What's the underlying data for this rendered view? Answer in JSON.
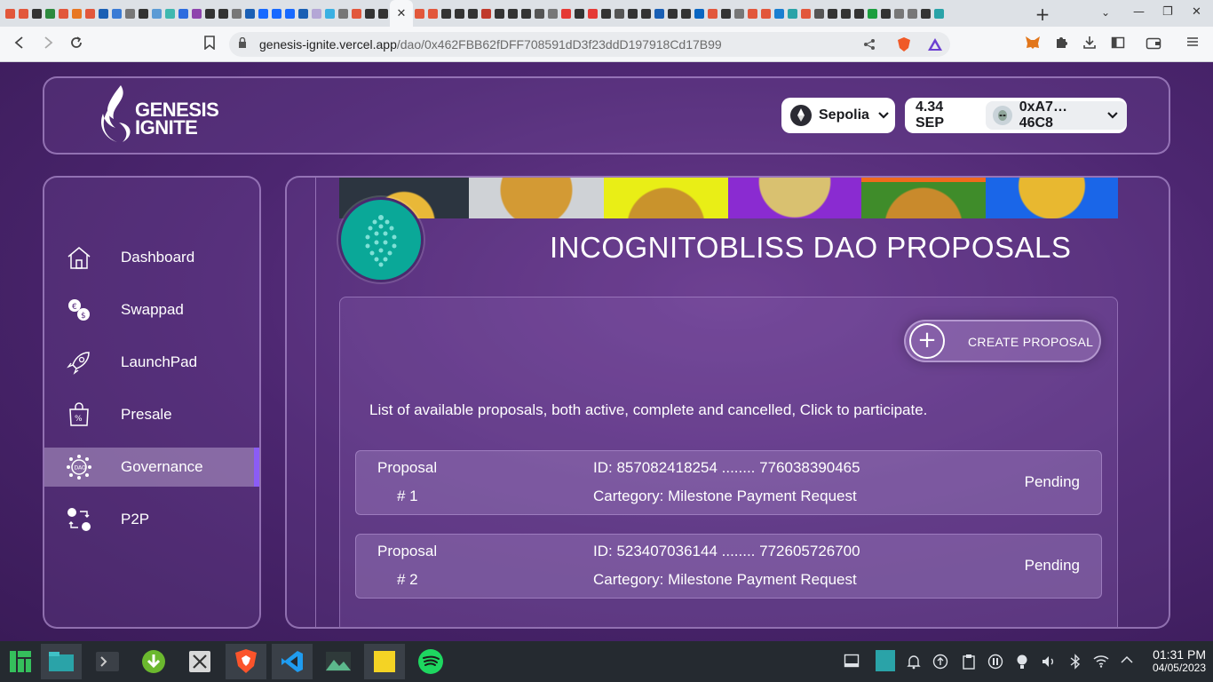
{
  "browser": {
    "url_host": "genesis-ignite.vercel.app",
    "url_path": "/dao/0x462FBB62fDFF708591dD3f23ddD197918Cd17B99",
    "tab_close_glyph": "✕",
    "new_tab_glyph": "+",
    "tab_list_glyph": "⌄",
    "minimize_glyph": "—",
    "restore_glyph": "❐",
    "close_glyph": "✕"
  },
  "header": {
    "logo_line1": "GENESIS",
    "logo_line2": "IGNITE",
    "network": "Sepolia",
    "balance": "4.34 SEP",
    "address": "0xA7…46C8"
  },
  "sidebar": {
    "items": [
      {
        "label": "Dashboard",
        "icon": "home-icon"
      },
      {
        "label": "Swappad",
        "icon": "swap-icon"
      },
      {
        "label": "LaunchPad",
        "icon": "rocket-icon"
      },
      {
        "label": "Presale",
        "icon": "presale-bag-icon"
      },
      {
        "label": "Governance",
        "icon": "dao-icon"
      },
      {
        "label": "P2P",
        "icon": "p2p-icon"
      }
    ],
    "active": "Governance"
  },
  "main": {
    "title": "INCOGNITOBLISS DAO PROPOSALS",
    "create_button": "CREATE PROPOSAL",
    "intro": "List of available proposals, both active, complete and cancelled, Click to participate.",
    "proposals": [
      {
        "label": "Proposal",
        "number": "# 1",
        "id": "ID: 857082418254 ........ 776038390465",
        "category": "Cartegory: Milestone Payment Request",
        "status": "Pending"
      },
      {
        "label": "Proposal",
        "number": "# 2",
        "id": "ID: 523407036144 ........ 772605726700",
        "category": "Cartegory: Milestone Payment Request",
        "status": "Pending"
      }
    ]
  },
  "taskbar": {
    "time": "01:31 PM",
    "date": "04/05/2023"
  },
  "colors": {
    "page_bg": "#4c2670",
    "accent": "#8b5cf6",
    "dao_avatar": "#0aa898"
  }
}
